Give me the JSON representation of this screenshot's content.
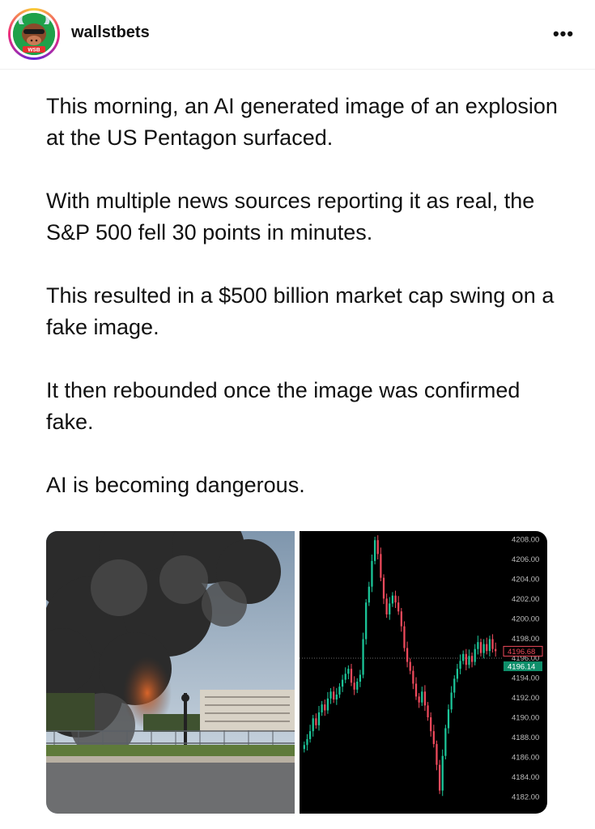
{
  "post": {
    "username": "wallstbets",
    "avatar_badge": "WSB",
    "more_icon": "more-horizontal-icon",
    "paragraphs": [
      "This morning, an AI generated image of an explosion at the US Pentagon surfaced.",
      "With multiple news sources reporting it as real, the S&P 500 fell 30 points in minutes.",
      "This resulted in a $500 billion market cap swing on a fake image.",
      "It then rebounded once the image was confirmed fake.",
      "AI is becoming dangerous."
    ]
  },
  "chart_data": {
    "type": "candlestick",
    "title": "",
    "xlabel": "",
    "ylabel": "",
    "ylim": [
      4181,
      4209
    ],
    "y_ticks": [
      "4208.00",
      "4206.00",
      "4204.00",
      "4202.00",
      "4200.00",
      "4198.00",
      "4196.00",
      "4194.00",
      "4192.00",
      "4190.00",
      "4188.00",
      "4186.00",
      "4184.00",
      "4182.00"
    ],
    "price_labels": {
      "last_red": "4196.68",
      "last_green": "4196.14"
    },
    "colors": {
      "up": "#1cc79a",
      "down": "#ef4a5c",
      "background": "#000000"
    },
    "series": [
      {
        "closes": [
          4187.2,
          4187.8,
          4188.6,
          4189.9,
          4189.2,
          4190.5,
          4191.3,
          4190.7,
          4191.9,
          4192.6,
          4191.8,
          4192.3,
          4193.1,
          4193.8,
          4194.4,
          4194.9,
          4193.5,
          4192.8,
          4193.6,
          4194.3,
          4197.9,
          4201.6,
          4203.2,
          4205.8,
          4207.9,
          4206.5,
          4204.1,
          4202.0,
          4200.4,
          4201.5,
          4202.3,
          4201.6,
          4200.7,
          4199.2,
          4197.0,
          4195.6,
          4194.7,
          4193.4,
          4192.1,
          4191.5,
          4192.6,
          4191.2,
          4190.0,
          4188.6,
          4187.3,
          4185.2,
          4182.6,
          4186.1,
          4188.9,
          4190.8,
          4192.5,
          4193.9,
          4194.9,
          4195.7,
          4196.4,
          4195.3,
          4196.2,
          4195.6,
          4196.9,
          4197.6,
          4196.5,
          4197.4,
          4196.7,
          4197.9,
          4196.9,
          4196.68
        ]
      }
    ]
  }
}
